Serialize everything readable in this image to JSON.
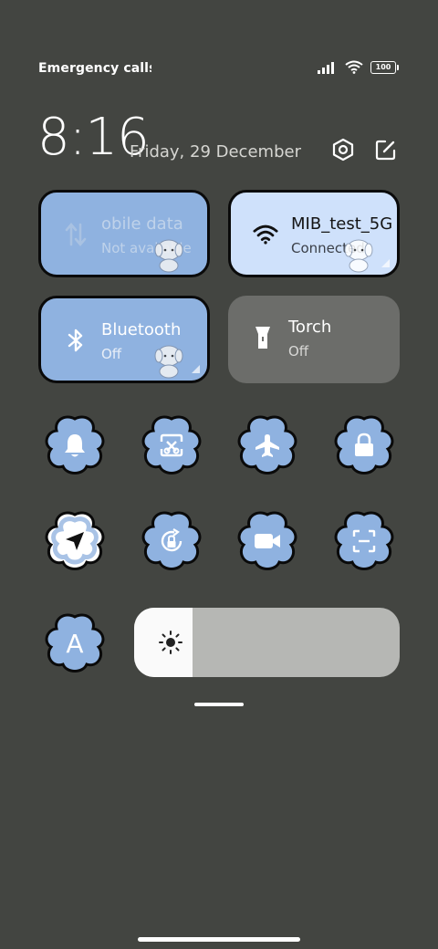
{
  "status": {
    "carrier_text": "Emergency calls o",
    "battery": "100"
  },
  "header": {
    "time": "8:16",
    "date": "Friday, 29 December"
  },
  "tiles": [
    {
      "name": "obile data",
      "sub": "Not available",
      "icon": "mobile-data-icon",
      "state": "on-unavailable"
    },
    {
      "name": "MIB_test_5G",
      "sub": "Connected",
      "icon": "wifi-icon",
      "state": "on"
    },
    {
      "name": "Bluetooth",
      "sub": "Off",
      "icon": "bluetooth-icon",
      "state": "off-themed"
    },
    {
      "name": "Torch",
      "sub": "Off",
      "icon": "torch-icon",
      "state": "off"
    }
  ],
  "toggles": [
    {
      "icon": "bell-icon"
    },
    {
      "icon": "screen-cast-icon"
    },
    {
      "icon": "airplane-icon"
    },
    {
      "icon": "lock-icon"
    },
    {
      "icon": "location-icon"
    },
    {
      "icon": "rotation-lock-icon"
    },
    {
      "icon": "video-camera-icon"
    },
    {
      "icon": "scan-icon"
    },
    {
      "icon": "font-size-icon",
      "label": "A"
    }
  ],
  "brightness": {
    "level": 0.22
  },
  "colors": {
    "background": "#434541",
    "tile_blue": "#8fb2e0",
    "tile_light": "#cfe1fb",
    "tile_gray": "#6c6d6a"
  }
}
